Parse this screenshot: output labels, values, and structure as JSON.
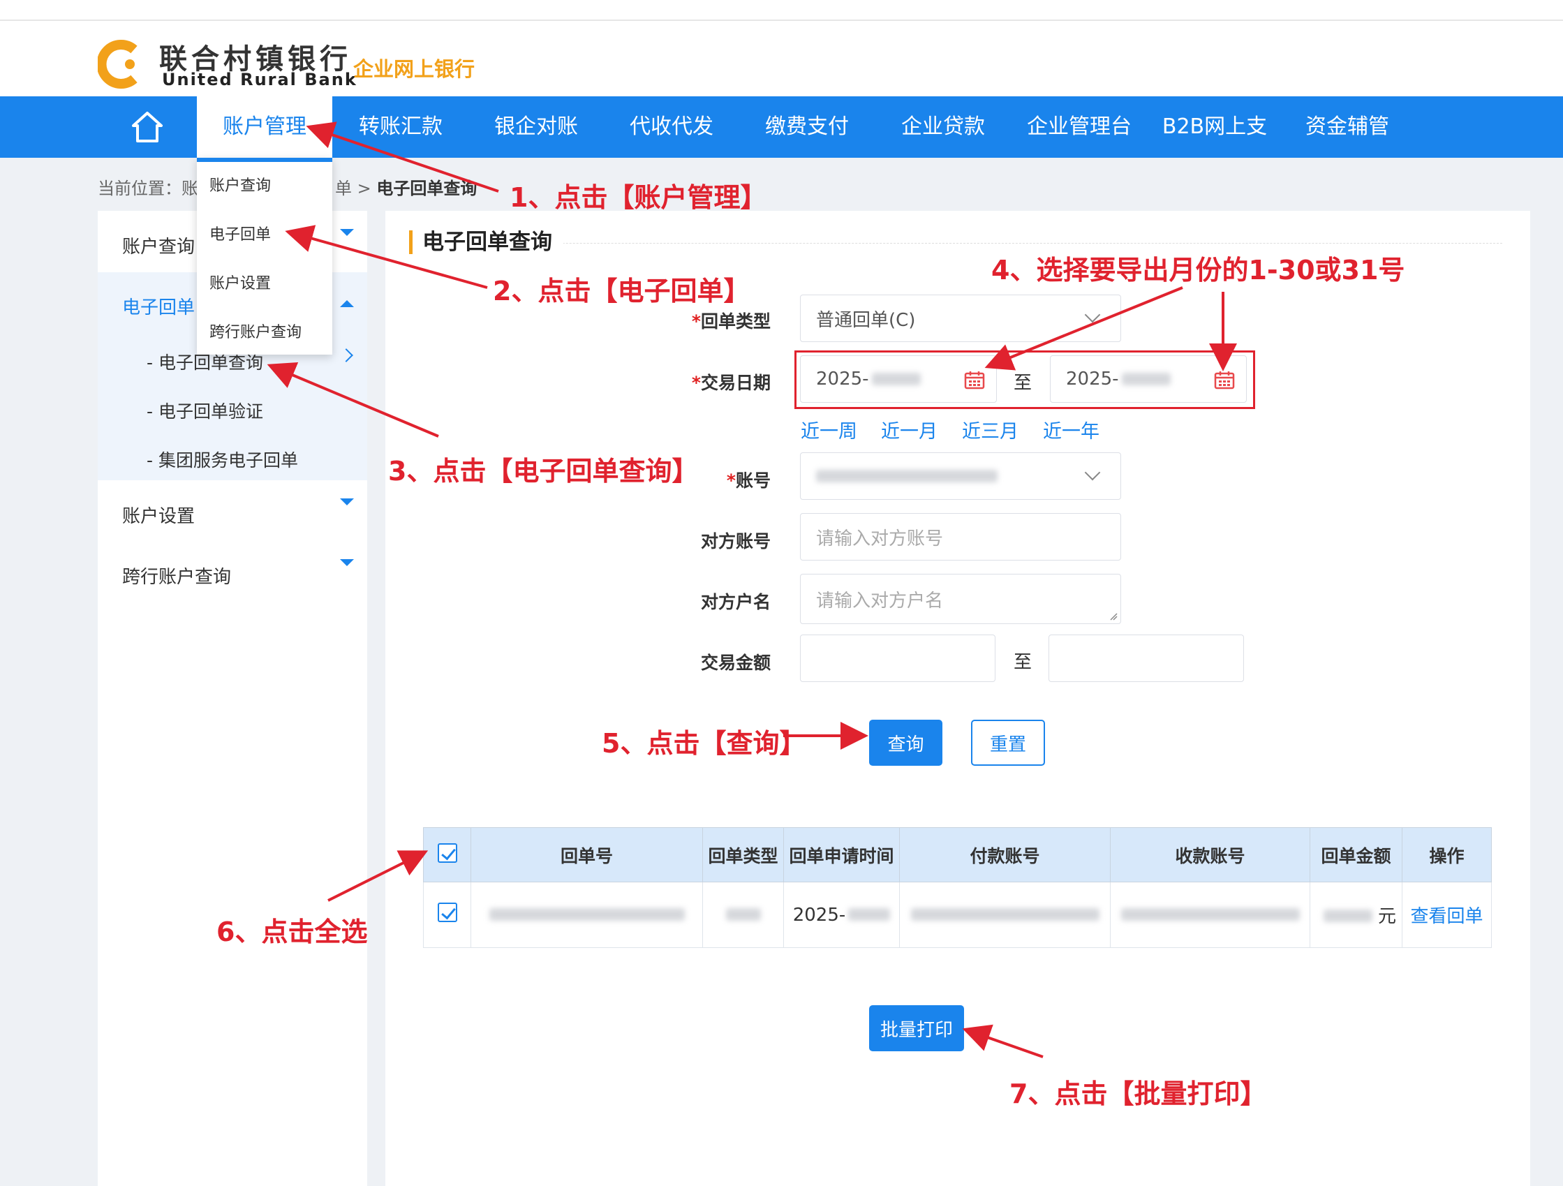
{
  "header": {
    "logo_cn": "联合村镇银行",
    "logo_en": "United Rural Bank",
    "logo_sub": "企业网上银行"
  },
  "nav": {
    "items": [
      "账户管理",
      "转账汇款",
      "银企对账",
      "代收代发",
      "缴费支付",
      "企业贷款",
      "企业管理台",
      "B2B网上支付",
      "资金辅管"
    ]
  },
  "dropdown": {
    "items": [
      "账户查询",
      "电子回单",
      "账户设置",
      "跨行账户查询"
    ]
  },
  "breadcrumb": {
    "prefix": "当前位置：",
    "part1": "账",
    "part2": "单 >",
    "current": "电子回单查询"
  },
  "sidebar": {
    "account_query": "账户查询",
    "e_receipt": "电子回单",
    "sub_items": [
      "- 电子回单查询",
      "- 电子回单验证",
      "- 集团服务电子回单"
    ],
    "account_settings": "账户设置",
    "cross_bank": "跨行账户查询"
  },
  "form": {
    "title": "电子回单查询",
    "required_mark": "*",
    "receipt_type_label": "回单类型",
    "receipt_type_value": "普通回单(C)",
    "trade_date_label": "交易日期",
    "date_start_prefix": "2025-",
    "date_end_prefix": "2025-",
    "to_label": "至",
    "quick_ranges": [
      "近一周",
      "近一月",
      "近三月",
      "近一年"
    ],
    "account_label": "账号",
    "counter_account_label": "对方账号",
    "counter_account_placeholder": "请输入对方账号",
    "counter_name_label": "对方户名",
    "counter_name_placeholder": "请输入对方户名",
    "amount_label": "交易金额",
    "query_button": "查询",
    "reset_button": "重置"
  },
  "table": {
    "headers": [
      "回单号",
      "回单类型",
      "回单申请时间",
      "付款账号",
      "收款账号",
      "回单金额",
      "操作"
    ],
    "row": {
      "apply_time_prefix": "2025-",
      "amount_unit": "元",
      "action": "查看回单"
    }
  },
  "batch_print_button": "批量打印",
  "annotations": {
    "step1": "1、点击【账户管理】",
    "step2": "2、点击【电子回单】",
    "step3": "3、点击【电子回单查询】",
    "step4": "4、选择要导出月份的1-30或31号",
    "step5": "5、点击【查询】",
    "step6": "6、点击全选",
    "step7": "7、点击【批量打印】",
    "color": "#e0222e"
  },
  "colors": {
    "primary": "#1a84ec",
    "accent": "#f2a11a"
  }
}
